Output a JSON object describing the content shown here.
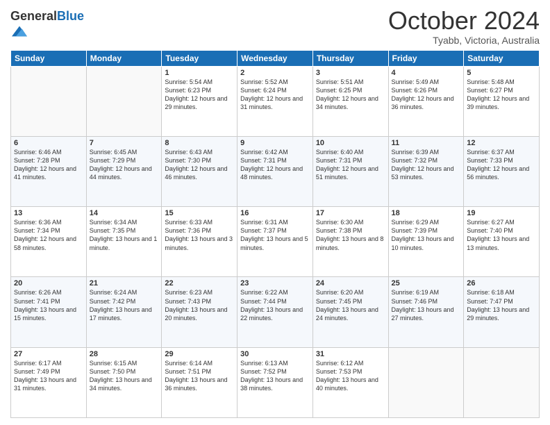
{
  "header": {
    "logo_general": "General",
    "logo_blue": "Blue",
    "month_title": "October 2024",
    "location": "Tyabb, Victoria, Australia"
  },
  "days_of_week": [
    "Sunday",
    "Monday",
    "Tuesday",
    "Wednesday",
    "Thursday",
    "Friday",
    "Saturday"
  ],
  "weeks": [
    [
      {
        "num": "",
        "info": ""
      },
      {
        "num": "",
        "info": ""
      },
      {
        "num": "1",
        "info": "Sunrise: 5:54 AM\nSunset: 6:23 PM\nDaylight: 12 hours\nand 29 minutes."
      },
      {
        "num": "2",
        "info": "Sunrise: 5:52 AM\nSunset: 6:24 PM\nDaylight: 12 hours\nand 31 minutes."
      },
      {
        "num": "3",
        "info": "Sunrise: 5:51 AM\nSunset: 6:25 PM\nDaylight: 12 hours\nand 34 minutes."
      },
      {
        "num": "4",
        "info": "Sunrise: 5:49 AM\nSunset: 6:26 PM\nDaylight: 12 hours\nand 36 minutes."
      },
      {
        "num": "5",
        "info": "Sunrise: 5:48 AM\nSunset: 6:27 PM\nDaylight: 12 hours\nand 39 minutes."
      }
    ],
    [
      {
        "num": "6",
        "info": "Sunrise: 6:46 AM\nSunset: 7:28 PM\nDaylight: 12 hours\nand 41 minutes."
      },
      {
        "num": "7",
        "info": "Sunrise: 6:45 AM\nSunset: 7:29 PM\nDaylight: 12 hours\nand 44 minutes."
      },
      {
        "num": "8",
        "info": "Sunrise: 6:43 AM\nSunset: 7:30 PM\nDaylight: 12 hours\nand 46 minutes."
      },
      {
        "num": "9",
        "info": "Sunrise: 6:42 AM\nSunset: 7:31 PM\nDaylight: 12 hours\nand 48 minutes."
      },
      {
        "num": "10",
        "info": "Sunrise: 6:40 AM\nSunset: 7:31 PM\nDaylight: 12 hours\nand 51 minutes."
      },
      {
        "num": "11",
        "info": "Sunrise: 6:39 AM\nSunset: 7:32 PM\nDaylight: 12 hours\nand 53 minutes."
      },
      {
        "num": "12",
        "info": "Sunrise: 6:37 AM\nSunset: 7:33 PM\nDaylight: 12 hours\nand 56 minutes."
      }
    ],
    [
      {
        "num": "13",
        "info": "Sunrise: 6:36 AM\nSunset: 7:34 PM\nDaylight: 12 hours\nand 58 minutes."
      },
      {
        "num": "14",
        "info": "Sunrise: 6:34 AM\nSunset: 7:35 PM\nDaylight: 13 hours\nand 1 minute."
      },
      {
        "num": "15",
        "info": "Sunrise: 6:33 AM\nSunset: 7:36 PM\nDaylight: 13 hours\nand 3 minutes."
      },
      {
        "num": "16",
        "info": "Sunrise: 6:31 AM\nSunset: 7:37 PM\nDaylight: 13 hours\nand 5 minutes."
      },
      {
        "num": "17",
        "info": "Sunrise: 6:30 AM\nSunset: 7:38 PM\nDaylight: 13 hours\nand 8 minutes."
      },
      {
        "num": "18",
        "info": "Sunrise: 6:29 AM\nSunset: 7:39 PM\nDaylight: 13 hours\nand 10 minutes."
      },
      {
        "num": "19",
        "info": "Sunrise: 6:27 AM\nSunset: 7:40 PM\nDaylight: 13 hours\nand 13 minutes."
      }
    ],
    [
      {
        "num": "20",
        "info": "Sunrise: 6:26 AM\nSunset: 7:41 PM\nDaylight: 13 hours\nand 15 minutes."
      },
      {
        "num": "21",
        "info": "Sunrise: 6:24 AM\nSunset: 7:42 PM\nDaylight: 13 hours\nand 17 minutes."
      },
      {
        "num": "22",
        "info": "Sunrise: 6:23 AM\nSunset: 7:43 PM\nDaylight: 13 hours\nand 20 minutes."
      },
      {
        "num": "23",
        "info": "Sunrise: 6:22 AM\nSunset: 7:44 PM\nDaylight: 13 hours\nand 22 minutes."
      },
      {
        "num": "24",
        "info": "Sunrise: 6:20 AM\nSunset: 7:45 PM\nDaylight: 13 hours\nand 24 minutes."
      },
      {
        "num": "25",
        "info": "Sunrise: 6:19 AM\nSunset: 7:46 PM\nDaylight: 13 hours\nand 27 minutes."
      },
      {
        "num": "26",
        "info": "Sunrise: 6:18 AM\nSunset: 7:47 PM\nDaylight: 13 hours\nand 29 minutes."
      }
    ],
    [
      {
        "num": "27",
        "info": "Sunrise: 6:17 AM\nSunset: 7:49 PM\nDaylight: 13 hours\nand 31 minutes."
      },
      {
        "num": "28",
        "info": "Sunrise: 6:15 AM\nSunset: 7:50 PM\nDaylight: 13 hours\nand 34 minutes."
      },
      {
        "num": "29",
        "info": "Sunrise: 6:14 AM\nSunset: 7:51 PM\nDaylight: 13 hours\nand 36 minutes."
      },
      {
        "num": "30",
        "info": "Sunrise: 6:13 AM\nSunset: 7:52 PM\nDaylight: 13 hours\nand 38 minutes."
      },
      {
        "num": "31",
        "info": "Sunrise: 6:12 AM\nSunset: 7:53 PM\nDaylight: 13 hours\nand 40 minutes."
      },
      {
        "num": "",
        "info": ""
      },
      {
        "num": "",
        "info": ""
      }
    ]
  ]
}
